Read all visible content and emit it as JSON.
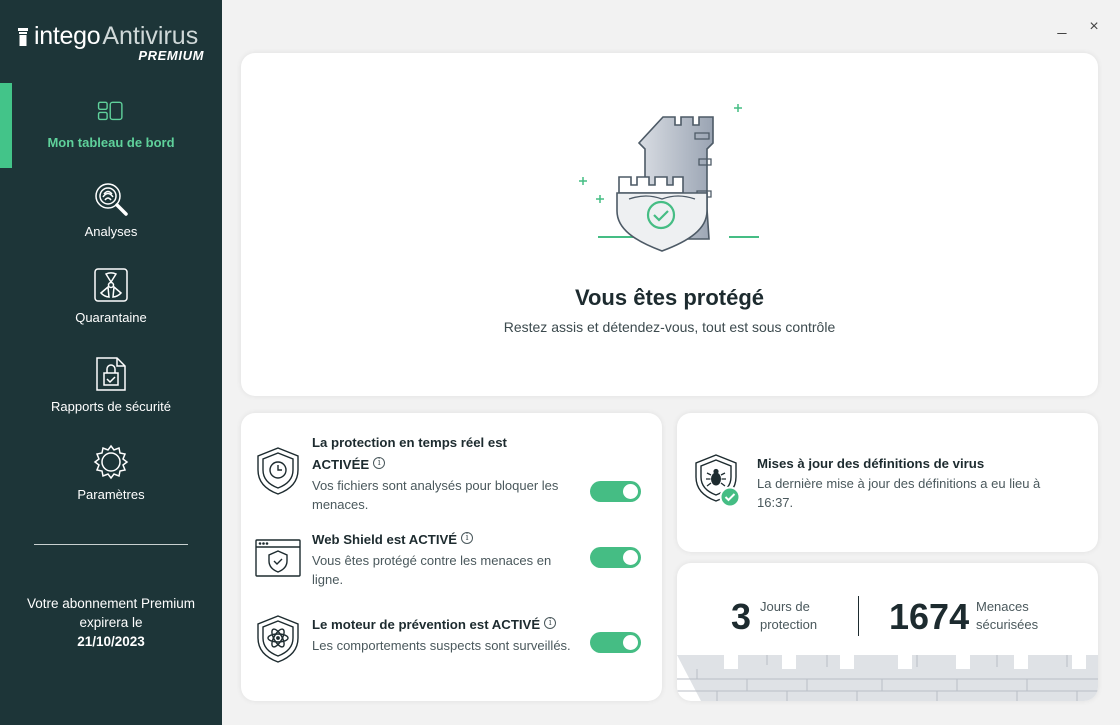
{
  "app": {
    "brand": "intego",
    "product": "Antivirus",
    "tier": "PREMIUM"
  },
  "window": {
    "minimize": "_",
    "close": "×"
  },
  "sidebar": {
    "items": [
      {
        "label": "Mon tableau de bord",
        "icon": "dashboard-icon",
        "active": true
      },
      {
        "label": "Analyses",
        "icon": "scan-icon",
        "active": false
      },
      {
        "label": "Quarantaine",
        "icon": "quarantine-icon",
        "active": false
      },
      {
        "label": "Rapports de sécurité",
        "icon": "reports-icon",
        "active": false
      },
      {
        "label": "Paramètres",
        "icon": "gear-icon",
        "active": false
      }
    ],
    "subscription": {
      "line1": "Votre abonnement Premium",
      "line2": "expirera le",
      "date": "21/10/2023"
    }
  },
  "hero": {
    "title": "Vous êtes protégé",
    "subtitle": "Restez assis et détendez-vous, tout est sous contrôle"
  },
  "protections": [
    {
      "title_a": "La protection en temps réel est",
      "title_b": "ACTIVÉE",
      "description": "Vos fichiers sont analysés pour bloquer les menaces.",
      "enabled": true,
      "icon": "clock-shield-icon"
    },
    {
      "title_a": "",
      "title_b": "Web Shield est ACTIVÉ",
      "description": "Vous êtes protégé contre les menaces en ligne.",
      "enabled": true,
      "icon": "browser-shield-icon"
    },
    {
      "title_a": "",
      "title_b": "Le moteur de prévention est ACTIVÉ",
      "description": "Les comportements suspects sont surveillés.",
      "enabled": true,
      "icon": "atom-shield-icon"
    }
  ],
  "definitions": {
    "title": "Mises à jour des définitions de virus",
    "description": "La dernière mise à jour des définitions a eu lieu à 16:37."
  },
  "stats": {
    "days_value": "3",
    "days_label_1": "Jours de",
    "days_label_2": "protection",
    "threats_value": "1674",
    "threats_label_1": "Menaces",
    "threats_label_2": "sécurisées"
  },
  "colors": {
    "sidebar_bg": "#1d3538",
    "accent": "#43c489",
    "toggle_on": "#45bd84",
    "text_dark": "#1d2b2f"
  }
}
